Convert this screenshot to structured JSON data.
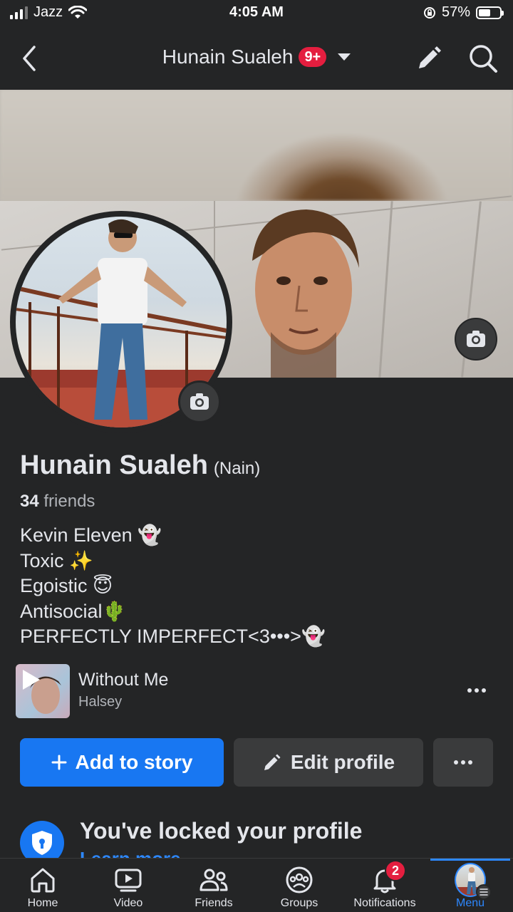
{
  "status_bar": {
    "carrier": "Jazz",
    "time": "4:05 AM",
    "battery": "57%",
    "battery_level": 0.57
  },
  "header": {
    "title": "Hunain Sualeh",
    "badge": "9+"
  },
  "profile": {
    "name": "Hunain Sualeh",
    "nickname": "(Nain)",
    "friends_count": "34",
    "friends_label": "friends",
    "bio": [
      "Kevin Eleven 👻",
      "Toxic ✨",
      "Egoistic 😇",
      "Antisocial🌵",
      "PERFECTLY IMPERFECT<3•••>👻"
    ]
  },
  "music": {
    "title": "Without Me",
    "artist": "Halsey"
  },
  "actions": {
    "add_story": "Add to story",
    "edit_profile": "Edit profile"
  },
  "locked": {
    "title": "You've locked your profile",
    "link": "Learn more"
  },
  "tabs": [
    {
      "label": "Home",
      "icon": "home-icon"
    },
    {
      "label": "Video",
      "icon": "video-icon"
    },
    {
      "label": "Friends",
      "icon": "friends-icon"
    },
    {
      "label": "Groups",
      "icon": "groups-icon"
    },
    {
      "label": "Notifications",
      "icon": "bell-icon",
      "badge": "2"
    },
    {
      "label": "Menu",
      "icon": "menu-avatar-icon",
      "active": true
    }
  ],
  "colors": {
    "accent": "#1877f2",
    "badge": "#e41e3f",
    "background": "#242526",
    "surface": "#3a3b3c"
  }
}
